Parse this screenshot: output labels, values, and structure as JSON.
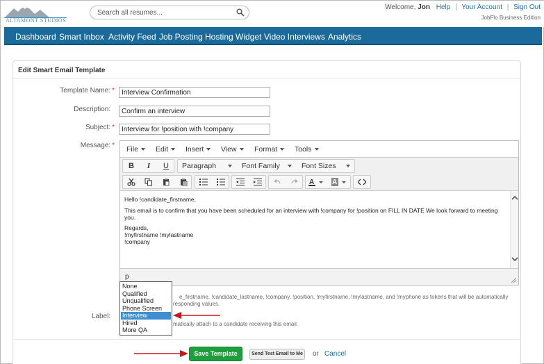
{
  "header": {
    "logo_text": "ALTAMONT STUDIOS",
    "search_placeholder": "Search all resumes...",
    "welcome_prefix": "Welcome,",
    "user_name": "Jon",
    "links": [
      "Help",
      "Your Account",
      "Sign Out"
    ],
    "separator": "|",
    "edition": "JobFlo Business Edition"
  },
  "nav": {
    "items": [
      "Dashboard",
      "Smart Inbox",
      "Activity Feed",
      "Job Posting",
      "Hosting Widget",
      "Video Interviews",
      "Analytics"
    ]
  },
  "panel": {
    "title": "Edit Smart Email Template"
  },
  "form": {
    "template_name_label": "Template Name:",
    "template_name_value": "Interview Confirmation",
    "description_label": "Description:",
    "description_value": "Confirm an interview",
    "subject_label": "Subject:",
    "subject_value": "Interview for !position with !company",
    "message_label": "Message:",
    "label_label": "Label:",
    "required_mark": "*"
  },
  "editor": {
    "menus": [
      "File",
      "Edit",
      "Insert",
      "View",
      "Format",
      "Tools"
    ],
    "format_buttons": [
      "B",
      "I",
      "U"
    ],
    "block_format": "Paragraph",
    "font_family": "Font Family",
    "font_sizes": "Font Sizes",
    "content": {
      "greeting": "Hello !candidate_firstname,",
      "body": "This email is to confirm that you have been scheduled for an interview with !company for !position on FILL IN DATE We look forward to meeting you.",
      "closing_1": "Regards,",
      "closing_2": "!myfirstname !mylastname",
      "closing_3": "!company"
    },
    "path": "p"
  },
  "help": {
    "tokens_line1": "e_firstname, !candidate_lastname, !company, !position, !myfirstname, !mylastname, and !myphone as tokens that will be automatically",
    "tokens_line2": "responding values.",
    "label_help": "matically attach to a candidate receiving this email."
  },
  "label_dropdown": {
    "options": [
      "None",
      "Qualified",
      "Unqualified",
      "Phone Screen",
      "Interview",
      "Hired",
      "More QA"
    ],
    "selected": "Interview"
  },
  "actions": {
    "save": "Save Template",
    "test": "Send Test Email to Me",
    "or": "or",
    "cancel": "Cancel"
  },
  "colors": {
    "nav_bg": "#1b6a9c",
    "save_bg": "#1f9e3d",
    "annotation_arrow": "#c8161d",
    "selected_option": "#3d8fd1"
  }
}
